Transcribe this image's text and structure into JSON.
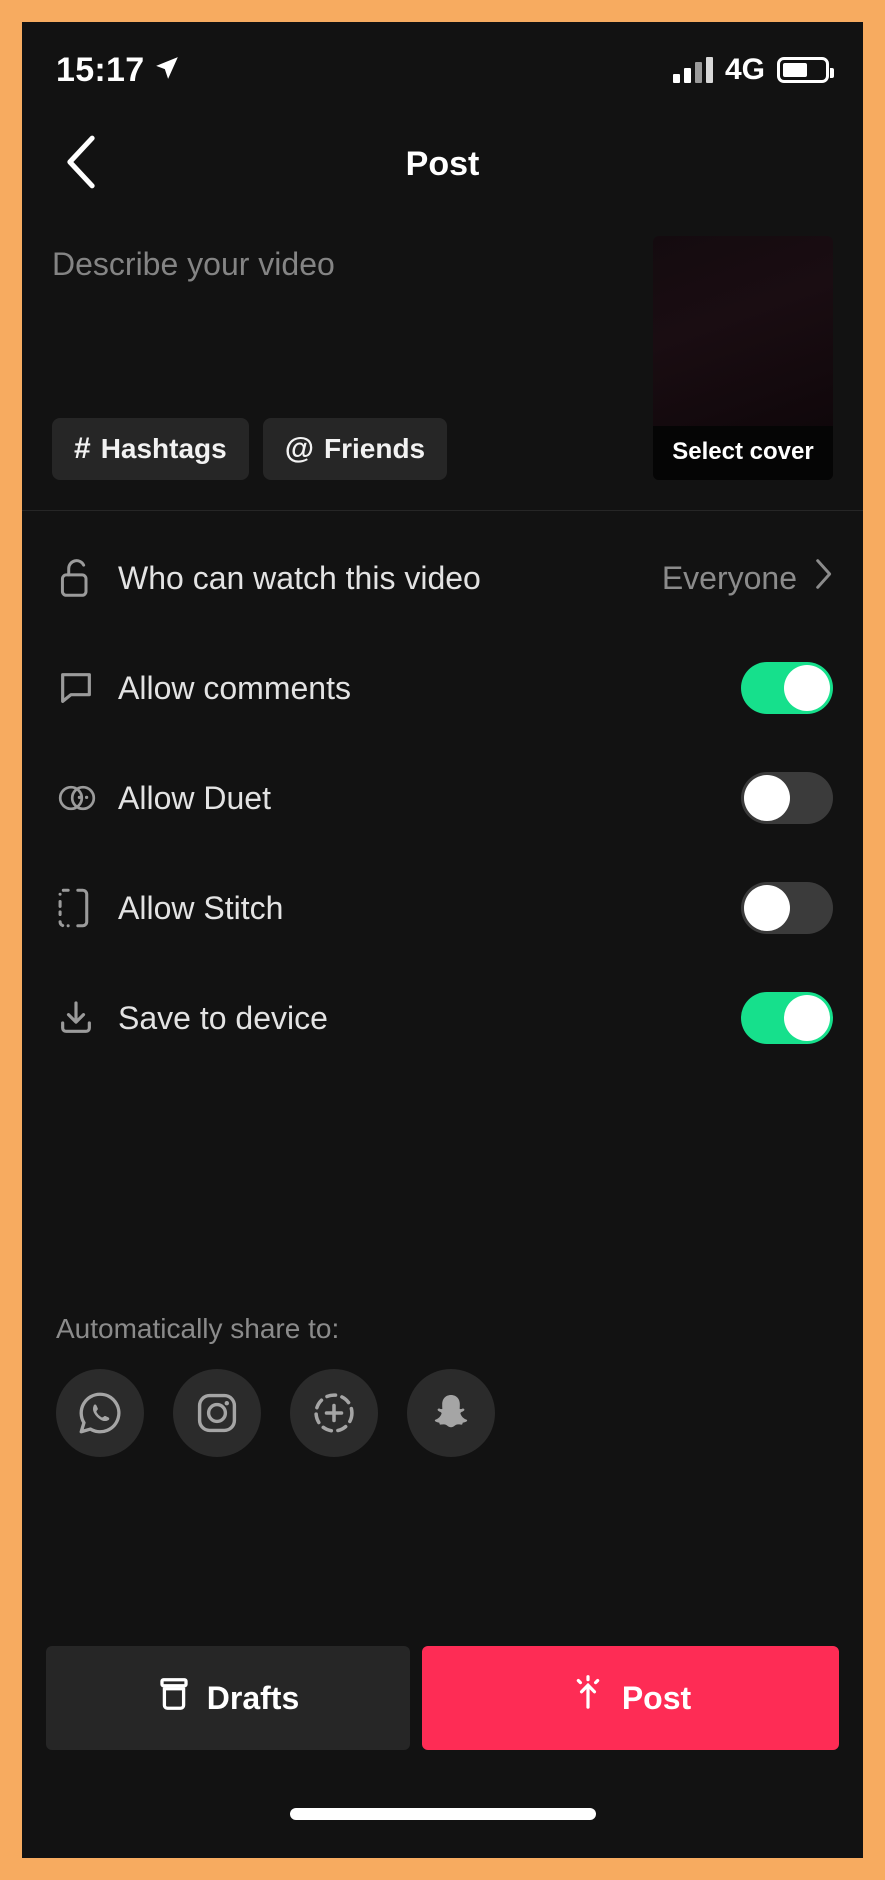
{
  "status_bar": {
    "time": "15:17",
    "location_icon": "location-arrow-icon",
    "network": "4G",
    "signal_icon": "signal-bars-icon",
    "battery_icon": "battery-icon"
  },
  "nav": {
    "back_icon": "chevron-left-icon",
    "title": "Post"
  },
  "describe": {
    "placeholder": "Describe your video",
    "value": "",
    "chips": [
      {
        "symbol": "#",
        "label": "Hashtags",
        "icon": "hashtag-icon"
      },
      {
        "symbol": "@",
        "label": "Friends",
        "icon": "at-sign-icon"
      }
    ],
    "cover": {
      "label": "Select cover",
      "icon": "video-cover-thumbnail"
    }
  },
  "settings": {
    "privacy": {
      "icon": "unlock-icon",
      "label": "Who can watch this video",
      "value": "Everyone",
      "chevron": "chevron-right-icon"
    },
    "toggles": [
      {
        "icon": "comment-bubble-icon",
        "label": "Allow comments",
        "state": "on"
      },
      {
        "icon": "duet-icon",
        "label": "Allow Duet",
        "state": "off"
      },
      {
        "icon": "stitch-icon",
        "label": "Allow Stitch",
        "state": "off"
      },
      {
        "icon": "download-icon",
        "label": "Save to device",
        "state": "on"
      }
    ]
  },
  "share": {
    "title": "Automatically share to:",
    "icons": [
      {
        "name": "whatsapp-icon"
      },
      {
        "name": "instagram-icon"
      },
      {
        "name": "instagram-story-icon"
      },
      {
        "name": "snapchat-icon"
      }
    ]
  },
  "actions": {
    "drafts_label": "Drafts",
    "drafts_icon": "drafts-icon",
    "post_label": "Post",
    "post_icon": "upload-arrow-icon"
  },
  "colors": {
    "background": "#121212",
    "frame": "#F7AB60",
    "toggle_on": "#16E08C",
    "toggle_off": "#3b3b3b",
    "post_button": "#FE2C55"
  }
}
